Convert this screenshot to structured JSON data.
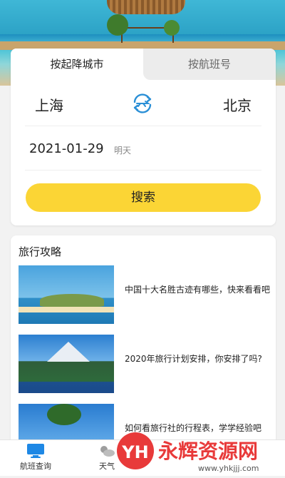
{
  "tabs": {
    "by_city": "按起降城市",
    "by_flight": "按航班号"
  },
  "route": {
    "from": "上海",
    "to": "北京"
  },
  "date": {
    "value": "2021-01-29",
    "label": "明天"
  },
  "search": {
    "label": "搜索"
  },
  "guide": {
    "title": "旅行攻略",
    "articles": [
      {
        "title": "中国十大名胜古迹有哪些，快来看看吧"
      },
      {
        "title": "2020年旅行计划安排，你安排了吗?"
      },
      {
        "title": "如何看旅行社的行程表，学学经验吧"
      }
    ]
  },
  "tabbar": {
    "items": [
      {
        "label": "航班查询",
        "icon": "monitor-icon"
      },
      {
        "label": "天气",
        "icon": "weather-icon"
      }
    ]
  },
  "watermark": {
    "text": "永辉资源网",
    "logo": "YH",
    "url": "www.yhkjjj.com"
  },
  "colors": {
    "accent": "#fbd535",
    "swap_icon": "#2a8fd6",
    "tab_active_icon": "#1e88e5"
  }
}
